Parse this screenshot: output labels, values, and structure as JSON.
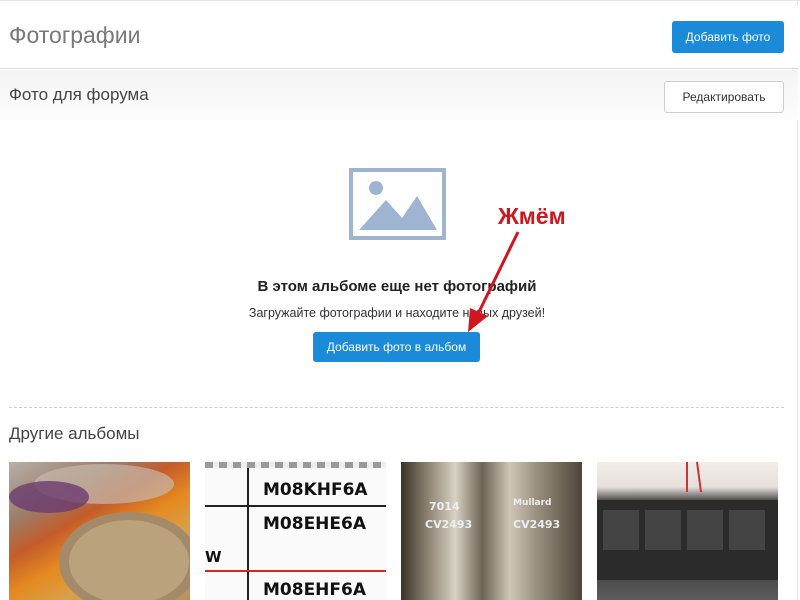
{
  "header": {
    "title": "Фотографии",
    "add_photo_label": "Добавить фото"
  },
  "album": {
    "title": "Фото для форума",
    "edit_label": "Редактировать",
    "empty_title": "В этом альбоме еще нет фотографий",
    "empty_subtitle": "Загружайте фотографии и находите новых друзей!",
    "add_to_album_label": "Добавить фото в альбом"
  },
  "annotation": {
    "text": "Жмём",
    "color": "#d0161e"
  },
  "other_albums": {
    "title": "Другие альбомы",
    "thumb2_codes": [
      "M08KHF6A",
      "M08EHE6A",
      "M08EHF6A"
    ],
    "thumb3_labels": [
      "7014",
      "CV2493",
      "CV2493",
      "Mullard"
    ]
  },
  "colors": {
    "accent": "#1a8ad9",
    "icon": "#9fb4d0"
  },
  "icons": {
    "placeholder": "image-placeholder-icon"
  }
}
